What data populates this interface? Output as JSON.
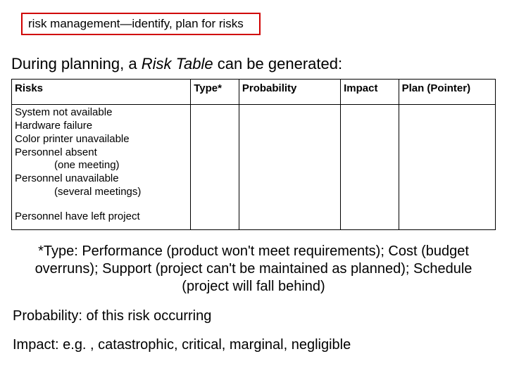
{
  "title": "risk management—identify, plan for risks",
  "intro_prefix": "During planning, a ",
  "intro_emph": "Risk Table",
  "intro_suffix": " can be generated:",
  "table": {
    "headers": {
      "risks": "Risks",
      "type": "Type*",
      "probability": "Probability",
      "impact": "Impact",
      "plan": "Plan (Pointer)"
    },
    "risk_rows": [
      "System not available",
      "Hardware failure",
      "Color printer unavailable",
      "Personnel absent",
      "(one meeting)",
      "Personnel unavailable",
      "(several meetings)"
    ],
    "risk_last": "Personnel have left project"
  },
  "footnote": "*Type:  Performance (product won't meet requirements); Cost (budget overruns); Support (project can't be maintained as planned); Schedule (project will fall behind)",
  "prob_def": "Probability:  of this risk occurring",
  "impact_def": "Impact:  e.g. , catastrophic, critical, marginal, negligible"
}
